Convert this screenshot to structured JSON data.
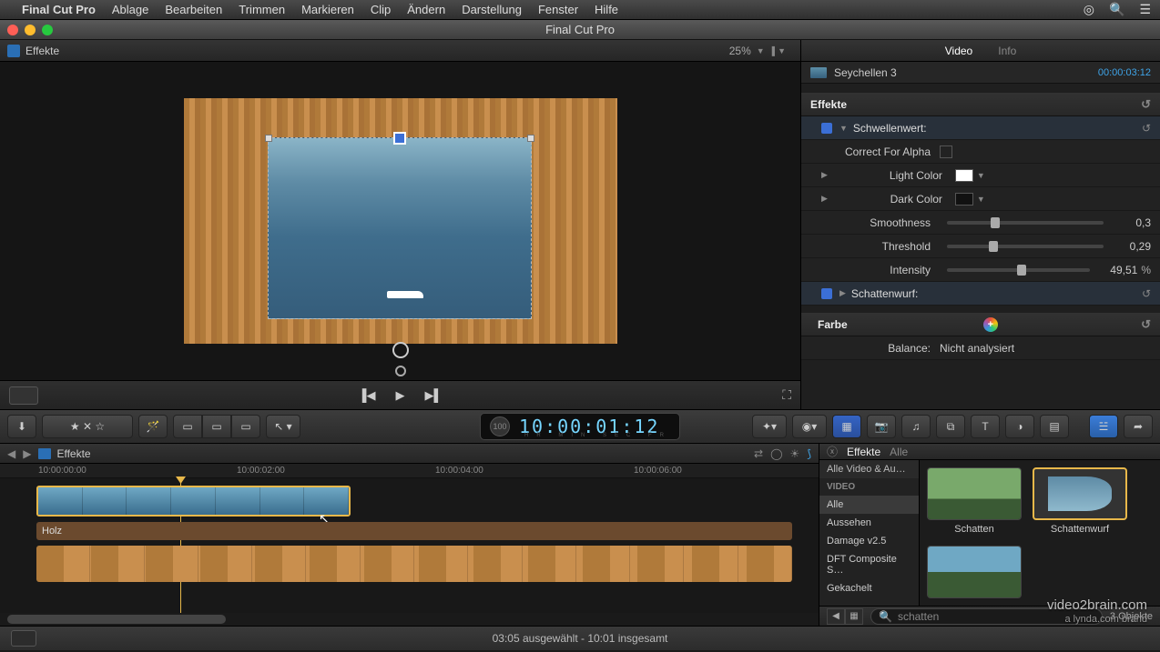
{
  "menubar": {
    "app": "Final Cut Pro",
    "items": [
      "Ablage",
      "Bearbeiten",
      "Trimmen",
      "Markieren",
      "Clip",
      "Ändern",
      "Darstellung",
      "Fenster",
      "Hilfe"
    ]
  },
  "window_title": "Final Cut Pro",
  "viewer": {
    "title": "Effekte",
    "zoom": "25%"
  },
  "inspector": {
    "tabs": {
      "video": "Video",
      "info": "Info"
    },
    "clip_name": "Seychellen 3",
    "clip_tc": "00:00:03:12",
    "section_effects": "Effekte",
    "eff1": {
      "name": "Schwellenwert:",
      "correct_alpha": "Correct For Alpha",
      "light_color": "Light Color",
      "dark_color": "Dark Color",
      "smoothness": "Smoothness",
      "smoothness_v": "0,3",
      "threshold": "Threshold",
      "threshold_v": "0,29",
      "intensity": "Intensity",
      "intensity_v": "49,51",
      "intensity_u": "%"
    },
    "eff2": {
      "name": "Schattenwurf:"
    },
    "color_section": "Farbe",
    "balance_label": "Balance:",
    "balance_value": "Nicht analysiert"
  },
  "toolbar": {
    "tc_badge": "100",
    "timecode": "10:00:01:12",
    "tc_units": "HR MIN SEC FR"
  },
  "timeline": {
    "name": "Effekte",
    "ruler": {
      "t0": "10:00:00:00",
      "t2": "10:00:02:00",
      "t4": "10:00:04:00",
      "t6": "10:00:06:00"
    },
    "track2_label": "Holz"
  },
  "fx": {
    "title": "Effekte",
    "scope": "Alle",
    "filter_header": "Alle Video & Au…",
    "cat_label": "VIDEO",
    "cats": [
      "Alle",
      "Aussehen",
      "Damage v2.5",
      "DFT Composite S…",
      "Gekachelt"
    ],
    "items": [
      "Schatten",
      "Schattenwurf"
    ],
    "search": "schatten",
    "count": "3 Objekte"
  },
  "status": {
    "text": "03:05 ausgewählt - 10:01 insgesamt"
  },
  "watermark": {
    "l1": "video2brain.com",
    "l2": "a lynda.com brand"
  }
}
